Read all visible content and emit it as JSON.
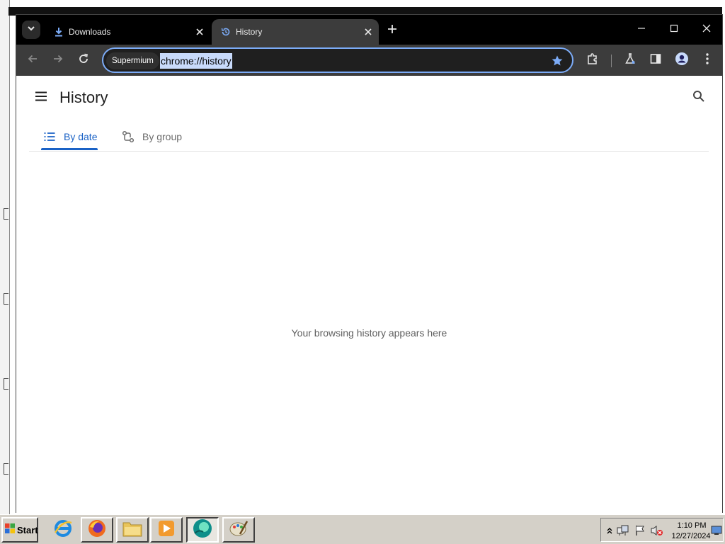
{
  "browser": {
    "tabs": [
      {
        "title": "Downloads",
        "icon": "download-icon",
        "active": false
      },
      {
        "title": "History",
        "icon": "history-icon",
        "active": true
      }
    ],
    "omnibox": {
      "chip": "Supermium",
      "url": "chrome://history"
    },
    "colors": {
      "titlebar": "#000000",
      "toolbar": "#3c3c3c",
      "accent": "#7cacf8",
      "url_highlight": "#c8dafb"
    }
  },
  "page": {
    "title": "History",
    "tabs": [
      {
        "label": "By date",
        "icon": "list-icon",
        "selected": true
      },
      {
        "label": "By group",
        "icon": "group-icon",
        "selected": false
      }
    ],
    "empty_message": "Your browsing history appears here",
    "accent": "#1a62c6"
  },
  "taskbar": {
    "start_label": "Start",
    "apps": [
      "internet-explorer-icon",
      "firefox-icon",
      "file-explorer-icon",
      "media-player-icon",
      "supermium-icon",
      "paint-icon"
    ],
    "clock": {
      "time": "1:10 PM",
      "date": "12/27/2024"
    }
  }
}
